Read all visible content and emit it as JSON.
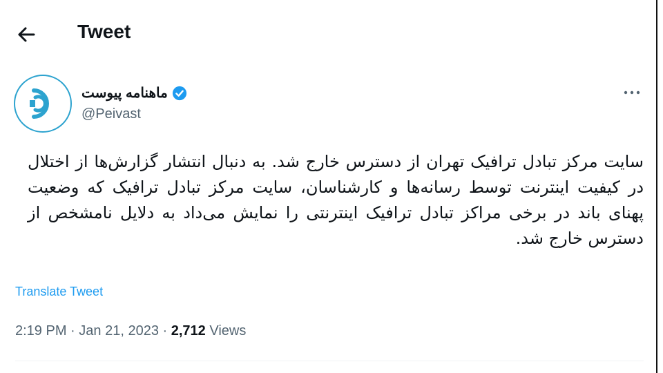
{
  "header": {
    "title": "Tweet"
  },
  "author": {
    "name": "ماهنامه پیوست",
    "handle": "@Peivast"
  },
  "tweet": {
    "text": "سایت مرکز تبادل ترافیک تهران از دسترس خارج شد. به دنبال انتشار گزارش‌ها از اختلال در کیفیت اینترنت توسط رسانه‌ها و کارشناسان، سایت مرکز تبادل ترافیک که وضعیت پهنای باند در برخی مراکز تبادل ترافیک اینترنتی را نمایش می‌داد به دلایل نامشخص از دسترس خارج شد."
  },
  "translate_label": "Translate Tweet",
  "meta": {
    "time": "2:19 PM",
    "date": "Jan 21, 2023",
    "views_count": "2,712",
    "views_label": "Views",
    "sep": "·"
  },
  "colors": {
    "accent": "#1d9bf0",
    "avatar_ring": "#2da3cf"
  },
  "icons": {
    "back": "arrow-left-icon",
    "verified": "verified-badge-icon",
    "more": "more-horizontal-icon"
  }
}
